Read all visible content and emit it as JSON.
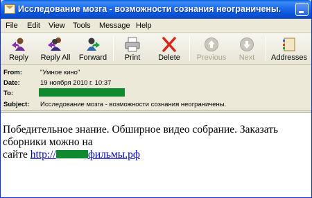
{
  "window": {
    "title": "Исследование мозга - возможности сознания неограничены."
  },
  "menu": [
    "File",
    "Edit",
    "View",
    "Tools",
    "Message",
    "Help"
  ],
  "toolbar": {
    "reply": "Reply",
    "reply_all": "Reply All",
    "forward": "Forward",
    "print": "Print",
    "delete": "Delete",
    "previous": "Previous",
    "next": "Next",
    "addresses": "Addresses"
  },
  "headers": {
    "from_label": "From:",
    "from_value": "\"Умное кино\"",
    "date_label": "Date:",
    "date_value": "19 ноября 2010 г. 10:37",
    "to_label": "To:",
    "subject_label": "Subject:",
    "subject_value": "Исследование мозга - возможности сознания неограничены."
  },
  "body": {
    "text_main": "Победительное знание. Обширное видео собрание. Заказать сборники можно на",
    "text_site": "сайте",
    "link_prefix": "http://",
    "link_suffix": "фильмы.рф"
  },
  "colors": {
    "title_bar": "#0a55d8",
    "redaction": "#0f8a2e",
    "link": "#0000cc"
  }
}
